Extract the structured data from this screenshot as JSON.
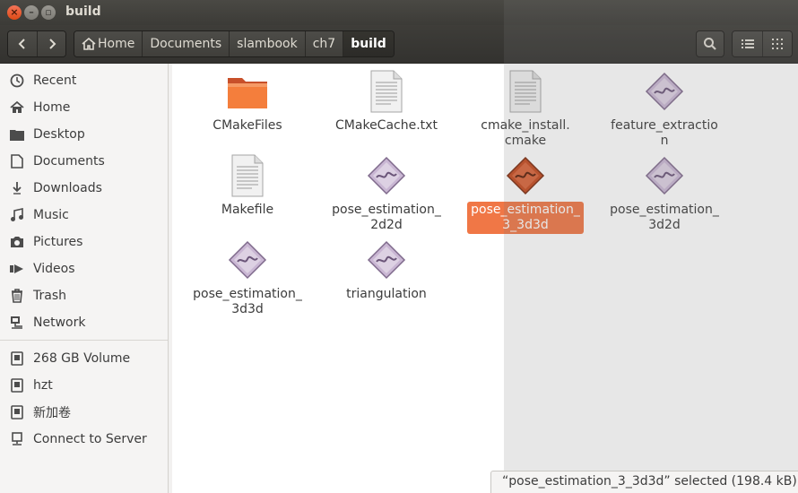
{
  "window": {
    "title": "build"
  },
  "breadcrumbs": [
    "Home",
    "Documents",
    "slambook",
    "ch7",
    "build"
  ],
  "sidebar": {
    "places": [
      "Recent",
      "Home",
      "Desktop",
      "Documents",
      "Downloads",
      "Music",
      "Pictures",
      "Videos",
      "Trash",
      "Network"
    ],
    "devices": [
      "268 GB Volume",
      "hzt",
      "新加卷",
      "Connect to Server"
    ]
  },
  "files": [
    {
      "line1": "CMakeFiles",
      "line2": "",
      "icon": "folder-icon"
    },
    {
      "line1": "CMakeCache.txt",
      "line2": "",
      "icon": "text-file-icon"
    },
    {
      "line1": "cmake_install.",
      "line2": "cmake",
      "icon": "text-file-icon"
    },
    {
      "line1": "feature_extraction",
      "line2": "",
      "icon": "executable-icon"
    },
    {
      "line1": "Makefile",
      "line2": "",
      "icon": "text-file-icon"
    },
    {
      "line1": "pose_estimation_",
      "line2": "2d2d",
      "icon": "executable-icon"
    },
    {
      "line1": "pose_estimation_",
      "line2": "3_3d3d",
      "icon": "executable-icon",
      "selected": true
    },
    {
      "line1": "pose_estimation_",
      "line2": "3d2d",
      "icon": "executable-icon"
    },
    {
      "line1": "pose_estimation_",
      "line2": "3d3d",
      "icon": "executable-icon"
    },
    {
      "line1": "triangulation",
      "line2": "",
      "icon": "executable-icon"
    }
  ],
  "status": {
    "text": "“pose_estimation_3_3d3d” selected  (198.4 kB)"
  },
  "colors": {
    "accent": "#f07746",
    "titlebar": "#3c3b37"
  }
}
